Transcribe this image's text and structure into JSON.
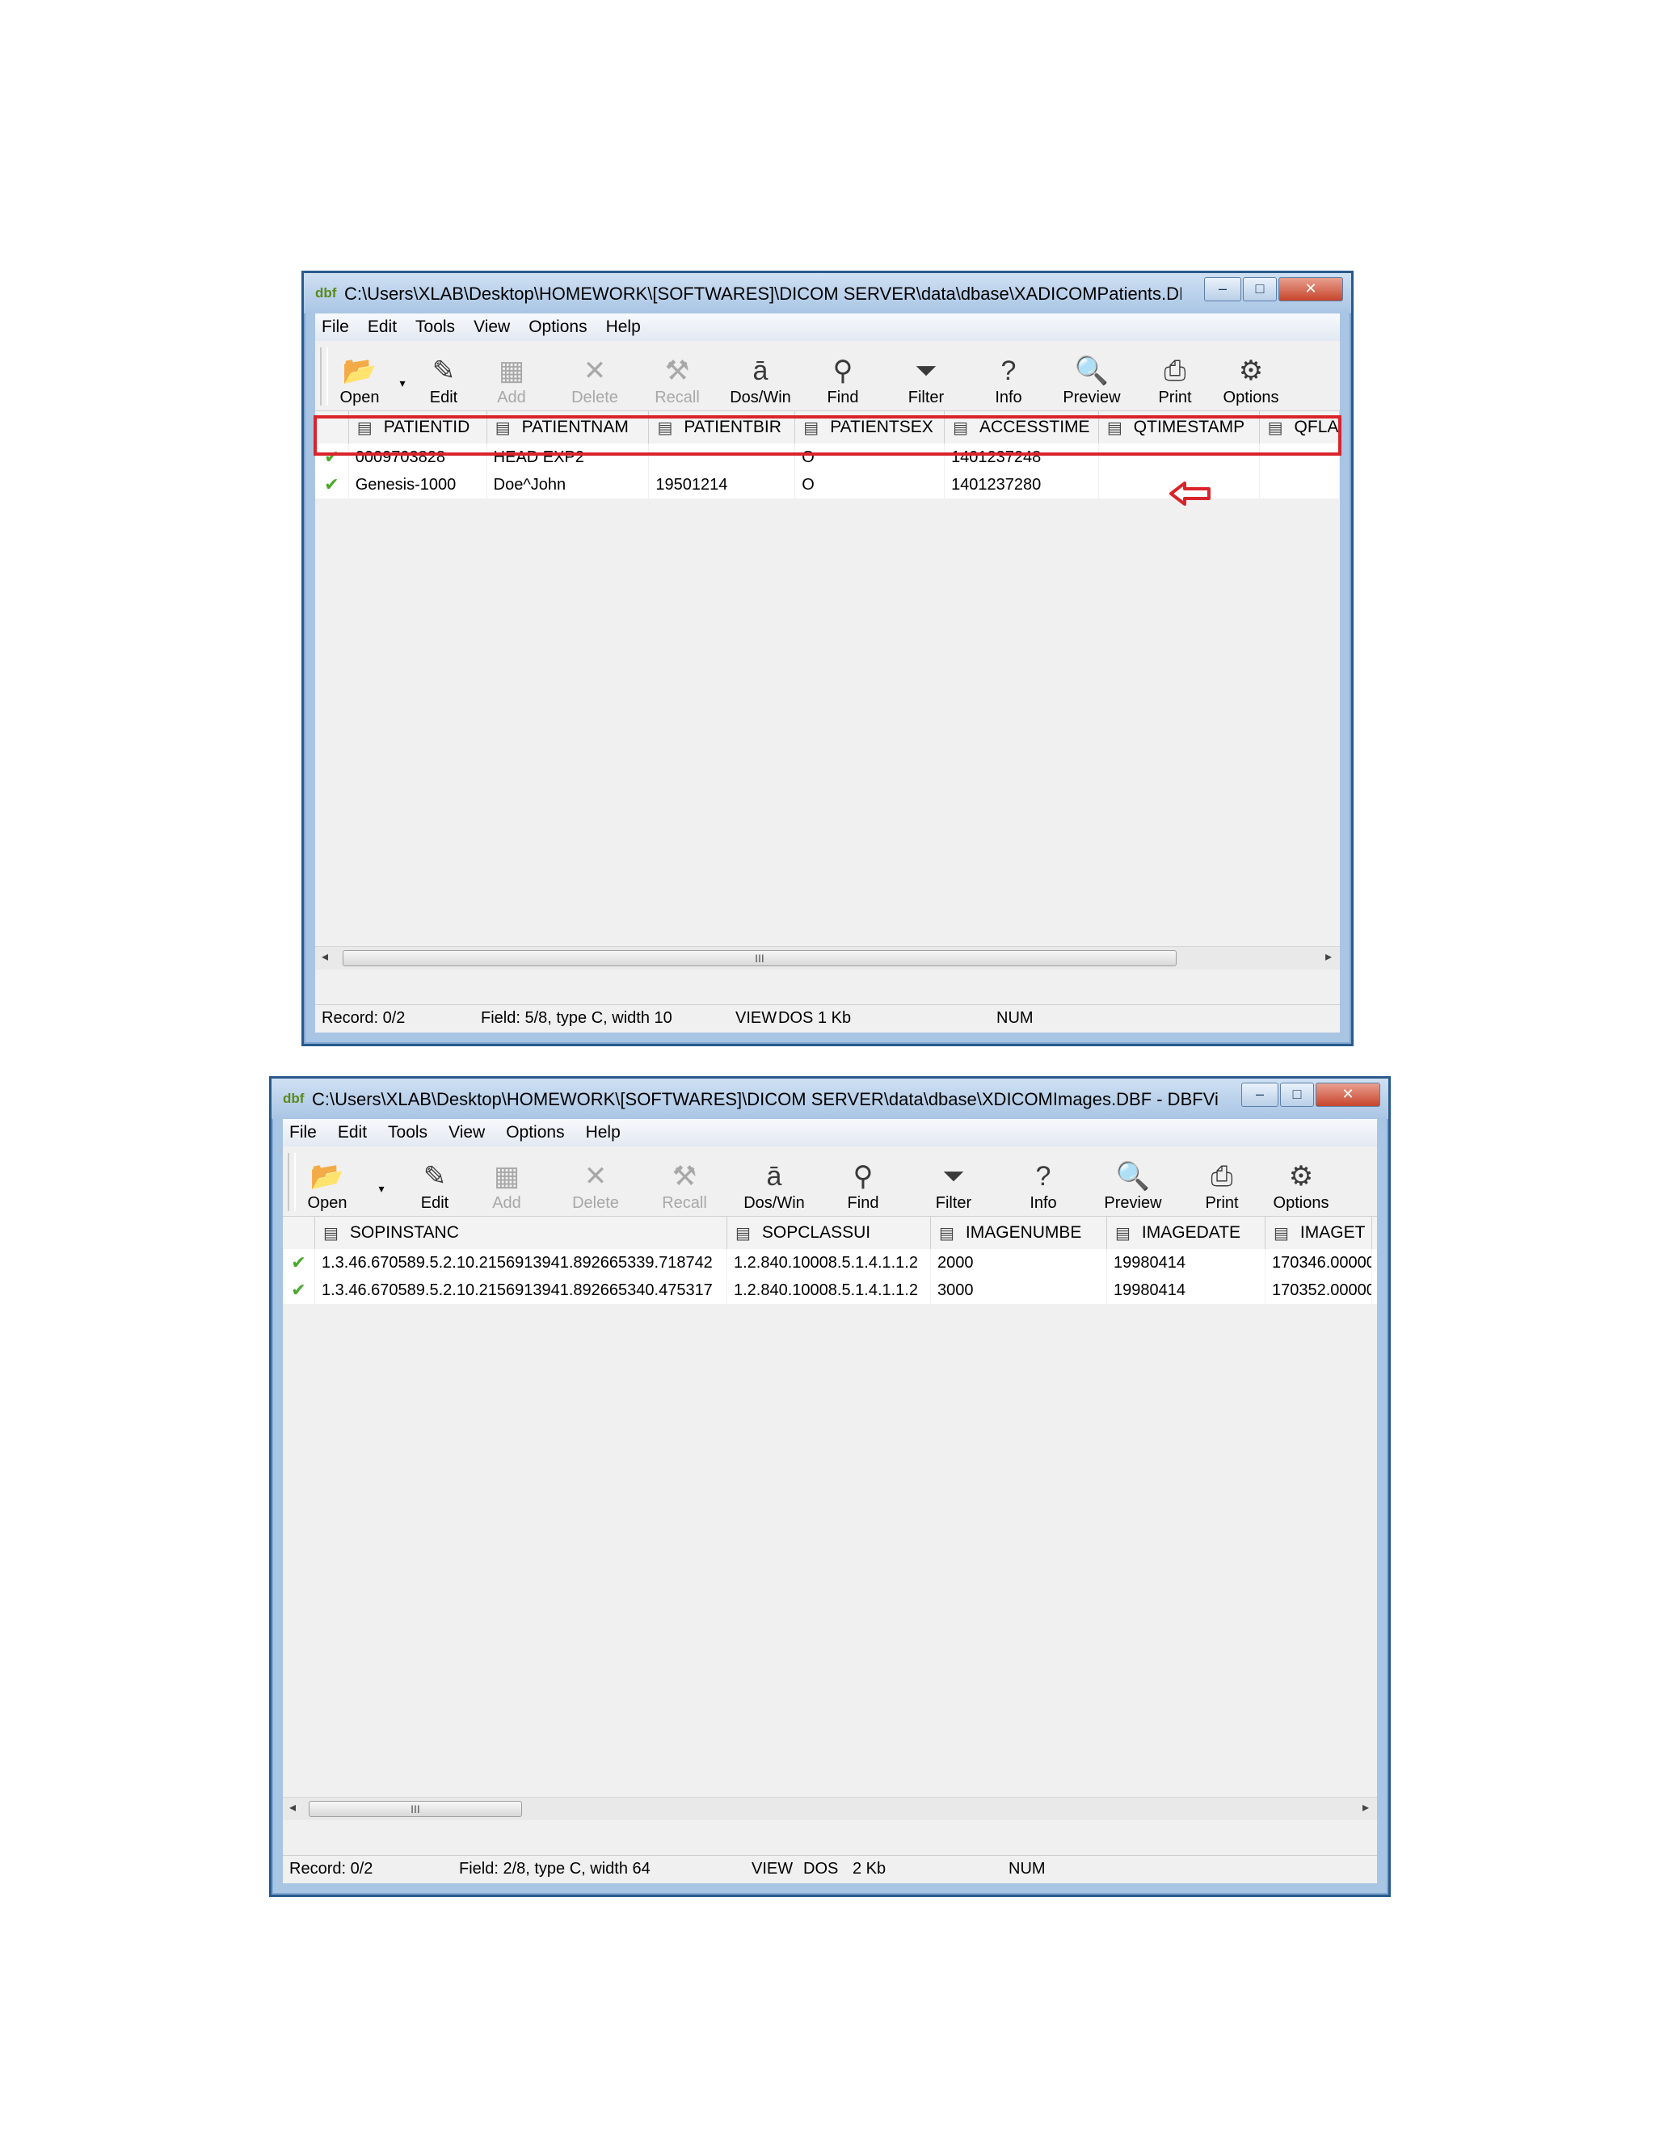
{
  "windows": [
    {
      "title": "C:\\Users\\XLAB\\Desktop\\HOMEWORK\\[SOFTWARES]\\DICOM SERVER\\data\\dbase\\XADICOMPatients.DBF - DBF...",
      "menu": [
        "File",
        "Edit",
        "Tools",
        "View",
        "Options",
        "Help"
      ],
      "toolbar": [
        "Open",
        "Edit",
        "Add",
        "Delete",
        "Recall",
        "Dos/Win",
        "Find",
        "Filter",
        "Info",
        "Preview",
        "Print",
        "Options"
      ],
      "columns": [
        "PATIENTID",
        "PATIENTNAM",
        "PATIENTBIR",
        "PATIENTSEX",
        "ACCESSTIME",
        "QTIMESTAMP",
        "QFLA"
      ],
      "rows": [
        [
          "0009703828",
          "HEAD EXP2",
          "",
          "O",
          "1401237248",
          "",
          ""
        ],
        [
          "Genesis-1000",
          "Doe^John",
          "19501214",
          "O",
          "1401237280",
          "",
          ""
        ]
      ],
      "status": {
        "record": "Record: 0/2",
        "field": "Field: 5/8, type C, width 10",
        "view": "VIEW",
        "dos": "DOS",
        "size": "1 Kb",
        "num": "NUM"
      }
    },
    {
      "title": "C:\\Users\\XLAB\\Desktop\\HOMEWORK\\[SOFTWARES]\\DICOM SERVER\\data\\dbase\\XDICOMImages.DBF - DBFVie...",
      "menu": [
        "File",
        "Edit",
        "Tools",
        "View",
        "Options",
        "Help"
      ],
      "toolbar": [
        "Open",
        "Edit",
        "Add",
        "Delete",
        "Recall",
        "Dos/Win",
        "Find",
        "Filter",
        "Info",
        "Preview",
        "Print",
        "Options"
      ],
      "columns": [
        "SOPINSTANC",
        "SOPCLASSUI",
        "IMAGENUMBE",
        "IMAGEDATE",
        "IMAGET"
      ],
      "rows": [
        [
          "1.3.46.670589.5.2.10.2156913941.892665339.718742",
          "1.2.840.10008.5.1.4.1.1.2",
          "2000",
          "19980414",
          "170346.00000"
        ],
        [
          "1.3.46.670589.5.2.10.2156913941.892665340.475317",
          "1.2.840.10008.5.1.4.1.1.2",
          "3000",
          "19980414",
          "170352.00000"
        ]
      ],
      "status": {
        "record": "Record: 0/2",
        "field": "Field: 2/8, type C, width 64",
        "view": "VIEW",
        "dos": "DOS",
        "size": "2 Kb",
        "num": "NUM"
      }
    }
  ],
  "icons": {
    "app": "dbf-app-icon",
    "column": "text-field-icon",
    "row": "green-check-icon",
    "annotation": "red-arrow-left-icon"
  },
  "colors": {
    "annotation": "#d9242b",
    "check": "#4aa82a",
    "window_frame": "#a9c5e4"
  },
  "symbols": {
    "minimize": "–",
    "maximize": "□",
    "close": "✕",
    "scroll_left": "◂",
    "scroll_right": "▸",
    "thumb": "III",
    "dropdown": "▾",
    "check": "✔",
    "column": "▤",
    "app": "dbf",
    "tb_open": "📂",
    "tb_edit": "✎",
    "tb_add": "▦",
    "tb_delete": "✕",
    "tb_recall": "⚒",
    "tb_doswin": "ā",
    "tb_find": "⚲",
    "tb_filter": "⏷",
    "tb_info": "?",
    "tb_preview": "🔍",
    "tb_print": "⎙",
    "tb_options": "⚙"
  }
}
